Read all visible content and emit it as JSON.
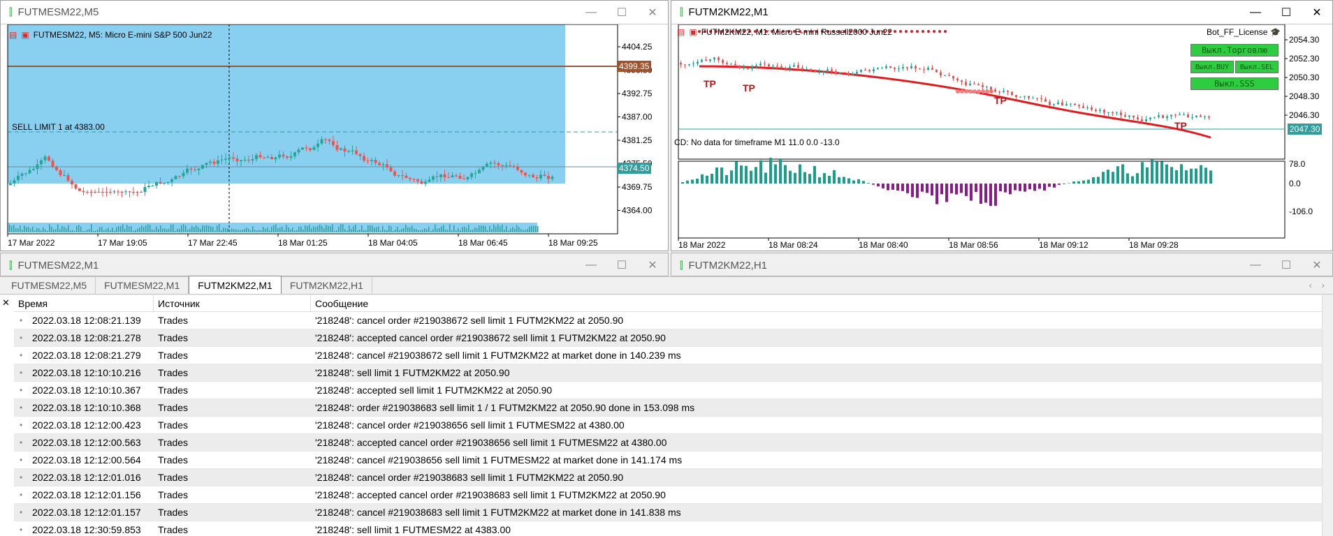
{
  "colors": {
    "bull": "#26a69a",
    "bear": "#ef5350",
    "panel": "#89cff0",
    "ma": "#e31a1c",
    "hist_pos": "#1a9e8a",
    "hist_neg": "#8b1a8b",
    "price_tag_green": "#2e9e9e",
    "price_tag_brown": "#a0522d"
  },
  "icons": {
    "chart": "candlestick-icon",
    "minimize": "minimize-icon",
    "maximize": "maximize-icon",
    "close": "close-icon"
  },
  "win1": {
    "title": "FUTMESM22,M5",
    "header": "FUTMESM22, M5:  Micro E-mini S&P 500 Jun22",
    "sell_limit": "SELL LIMIT 1 at 4383.00",
    "brown_tag": "4399.35",
    "green_tag": "4374.50",
    "yticks": [
      "4404.25",
      "4398.50",
      "4392.75",
      "4387.00",
      "4381.25",
      "4375.50",
      "4369.75",
      "4364.00"
    ],
    "xticks": [
      "17 Mar 2022",
      "17 Mar 19:05",
      "17 Mar 22:45",
      "18 Mar 01:25",
      "18 Mar 04:05",
      "18 Mar 06:45",
      "18 Mar 09:25"
    ]
  },
  "win2": {
    "title": "FUTM2KM22,M1",
    "header": "FUTM2KM22, M1:  Micro E-mini Russell2000 Jun22",
    "license": "Bot_FF_License",
    "btn_trade": "Выкл.Торговлю",
    "btn_buy": "Выкл.BUY",
    "btn_sell": "Выкл.SEL",
    "btn_sss": "Выкл.SSS",
    "price_tag": "2047.30",
    "yticks": [
      "2054.30",
      "2052.30",
      "2050.30",
      "2048.30",
      "2046.30"
    ],
    "ind_label": "CD: No data for timeframe M1 11.0 0.0 -13.0",
    "ind_yticks": [
      "78.0",
      "0.0",
      "-106.0"
    ],
    "xticks": [
      "18 Mar 2022",
      "18 Mar 08:24",
      "18 Mar 08:40",
      "18 Mar 08:56",
      "18 Mar 09:12",
      "18 Mar 09:28"
    ],
    "tp": "TP"
  },
  "win3": {
    "title": "FUTMESM22,M1"
  },
  "win4": {
    "title": "FUTM2KM22,H1"
  },
  "tabs": [
    "FUTMESM22,M5",
    "FUTMESM22,M1",
    "FUTM2KM22,M1",
    "FUTM2KM22,H1"
  ],
  "active_tab": 2,
  "log": {
    "columns": [
      "Время",
      "Источник",
      "Сообщение"
    ],
    "rows": [
      [
        "2022.03.18 12:08:21.139",
        "Trades",
        "'218248': cancel order #219038672 sell limit 1 FUTM2KM22 at 2050.90"
      ],
      [
        "2022.03.18 12:08:21.278",
        "Trades",
        "'218248': accepted cancel order #219038672 sell limit 1 FUTM2KM22 at 2050.90"
      ],
      [
        "2022.03.18 12:08:21.279",
        "Trades",
        "'218248': cancel #219038672 sell limit 1 FUTM2KM22 at market done in 140.239 ms"
      ],
      [
        "2022.03.18 12:10:10.216",
        "Trades",
        "'218248': sell limit 1 FUTM2KM22 at 2050.90"
      ],
      [
        "2022.03.18 12:10:10.367",
        "Trades",
        "'218248': accepted sell limit 1 FUTM2KM22 at 2050.90"
      ],
      [
        "2022.03.18 12:10:10.368",
        "Trades",
        "'218248': order #219038683 sell limit 1 / 1 FUTM2KM22 at 2050.90 done in 153.098 ms"
      ],
      [
        "2022.03.18 12:12:00.423",
        "Trades",
        "'218248': cancel order #219038656 sell limit 1 FUTMESM22 at 4380.00"
      ],
      [
        "2022.03.18 12:12:00.563",
        "Trades",
        "'218248': accepted cancel order #219038656 sell limit 1 FUTMESM22 at 4380.00"
      ],
      [
        "2022.03.18 12:12:00.564",
        "Trades",
        "'218248': cancel #219038656 sell limit 1 FUTMESM22 at market done in 141.174 ms"
      ],
      [
        "2022.03.18 12:12:01.016",
        "Trades",
        "'218248': cancel order #219038683 sell limit 1 FUTM2KM22 at 2050.90"
      ],
      [
        "2022.03.18 12:12:01.156",
        "Trades",
        "'218248': accepted cancel order #219038683 sell limit 1 FUTM2KM22 at 2050.90"
      ],
      [
        "2022.03.18 12:12:01.157",
        "Trades",
        "'218248': cancel #219038683 sell limit 1 FUTM2KM22 at market done in 141.838 ms"
      ],
      [
        "2022.03.18 12:30:59.853",
        "Trades",
        "'218248': sell limit 1 FUTMESM22 at 4383.00"
      ]
    ]
  }
}
